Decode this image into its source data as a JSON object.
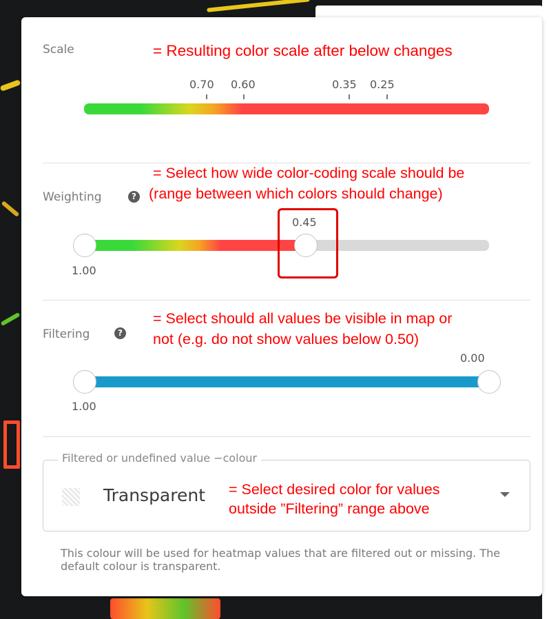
{
  "scale": {
    "label": "Scale",
    "annotation": "= Resulting color scale after below changes",
    "ticks": [
      "0.70",
      "0.60",
      "0.35",
      "0.25"
    ]
  },
  "weighting": {
    "label": "Weighting",
    "help_icon": "question-circle-icon",
    "annotation_line1": "= Select how wide color-coding scale should be",
    "annotation_line2": "(range between which colors should change)",
    "min_value": "1.00",
    "current_value": "0.45",
    "fill_fraction": 0.55
  },
  "filtering": {
    "label": "Filtering",
    "help_icon": "question-circle-icon",
    "annotation_line1": "= Select should all values be visible in map or",
    "annotation_line2": "not (e.g. do not show values below 0.50)",
    "min_value": "1.00",
    "max_value": "0.00"
  },
  "undefined_colour": {
    "legend": "Filtered or undefined value −colour",
    "selected": "Transparent",
    "annotation_line1": "= Select desired color for values",
    "annotation_line2": "outside ”Filtering” range above",
    "help_text": "This colour will be used for heatmap values that are filtered out or missing. The default colour is transparent."
  },
  "colors": {
    "annotation": "#ff0000",
    "scale_green": "#3ad93a",
    "scale_yellow": "#e3d31c",
    "scale_red": "#ff4444",
    "filter_blue": "#1a9acb",
    "track_grey": "#d9d9d9"
  }
}
